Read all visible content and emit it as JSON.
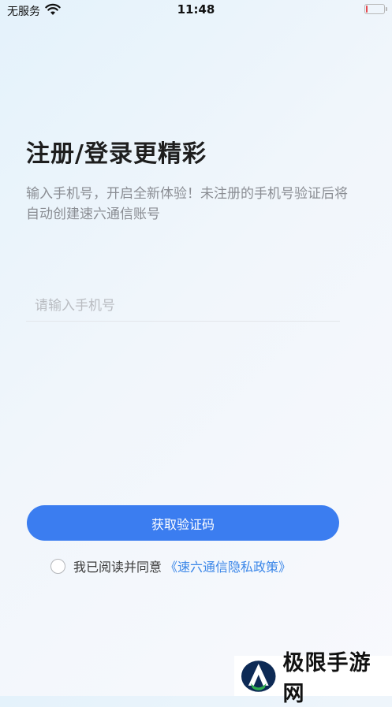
{
  "status_bar": {
    "carrier": "无服务",
    "time": "11:48",
    "battery_level": 0.1,
    "battery_color": "#e5484d"
  },
  "header": {
    "title": "注册/登录更精彩",
    "subtitle": "输入手机号，开启全新体验！未注册的手机号验证后将自动创建速六通信账号"
  },
  "form": {
    "phone_placeholder": "请输入手机号",
    "phone_value": ""
  },
  "actions": {
    "get_code_label": "获取验证码"
  },
  "agreement": {
    "prefix": "我已阅读并同意",
    "link": "《速六通信隐私政策》",
    "checked": false
  },
  "watermark": {
    "text": "极限手游网"
  },
  "colors": {
    "primary": "#3b7df0",
    "link": "#3a86e8"
  }
}
